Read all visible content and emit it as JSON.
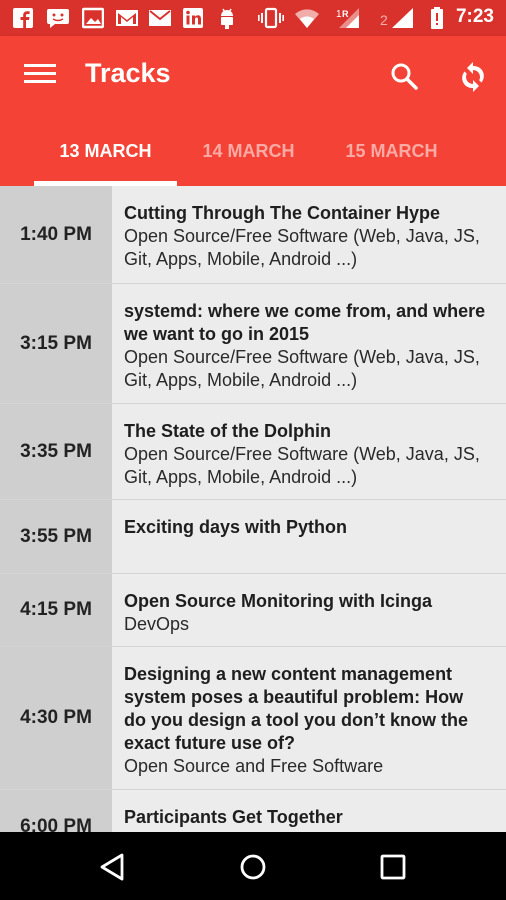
{
  "status_bar": {
    "time": "7:23",
    "icons": [
      "facebook-icon",
      "messenger-icon",
      "gallery-icon",
      "gmail-icon",
      "email-icon",
      "linkedin-icon",
      "android-icon",
      "vibrate-icon",
      "wifi-icon",
      "signal-r-icon",
      "signal-2-icon",
      "battery-icon"
    ]
  },
  "app_bar": {
    "title": "Tracks",
    "tabs": [
      {
        "label": "13 MARCH",
        "active": true
      },
      {
        "label": "14 MARCH",
        "active": false
      },
      {
        "label": "15 MARCH",
        "active": false
      }
    ]
  },
  "colors": {
    "primary": "#f44336",
    "primary_dark": "#d9322c",
    "time_column": "#cfcfcf",
    "row_background": "#ececec"
  },
  "talks": [
    {
      "time": "1:40 PM",
      "title": "Cutting Through The Container Hype",
      "track": "Open Source/Free Software (Web, Java, JS, Git, Apps, Mobile, Android ...)"
    },
    {
      "time": "3:15 PM",
      "title": "systemd: where we come from, and where we want to go in 2015",
      "track": "Open Source/Free Software (Web, Java, JS, Git, Apps, Mobile, Android ...)"
    },
    {
      "time": "3:35 PM",
      "title": "The State of the Dolphin",
      "track": "Open Source/Free Software (Web, Java, JS, Git, Apps, Mobile, Android ...)"
    },
    {
      "time": "3:55 PM",
      "title": "Exciting days with Python",
      "track": ""
    },
    {
      "time": "4:15 PM",
      "title": "Open Source Monitoring with Icinga",
      "track": "DevOps"
    },
    {
      "time": "4:30 PM",
      "title": "Designing a new content management system poses a beautiful problem: How do you design a tool you don’t know the exact future use of?",
      "track": "Open Source and Free Software"
    },
    {
      "time": "6:00 PM",
      "title": "Participants Get Together",
      "track": ""
    }
  ],
  "nav_bar": {
    "icons": [
      "back-icon",
      "home-icon",
      "recents-icon"
    ]
  }
}
